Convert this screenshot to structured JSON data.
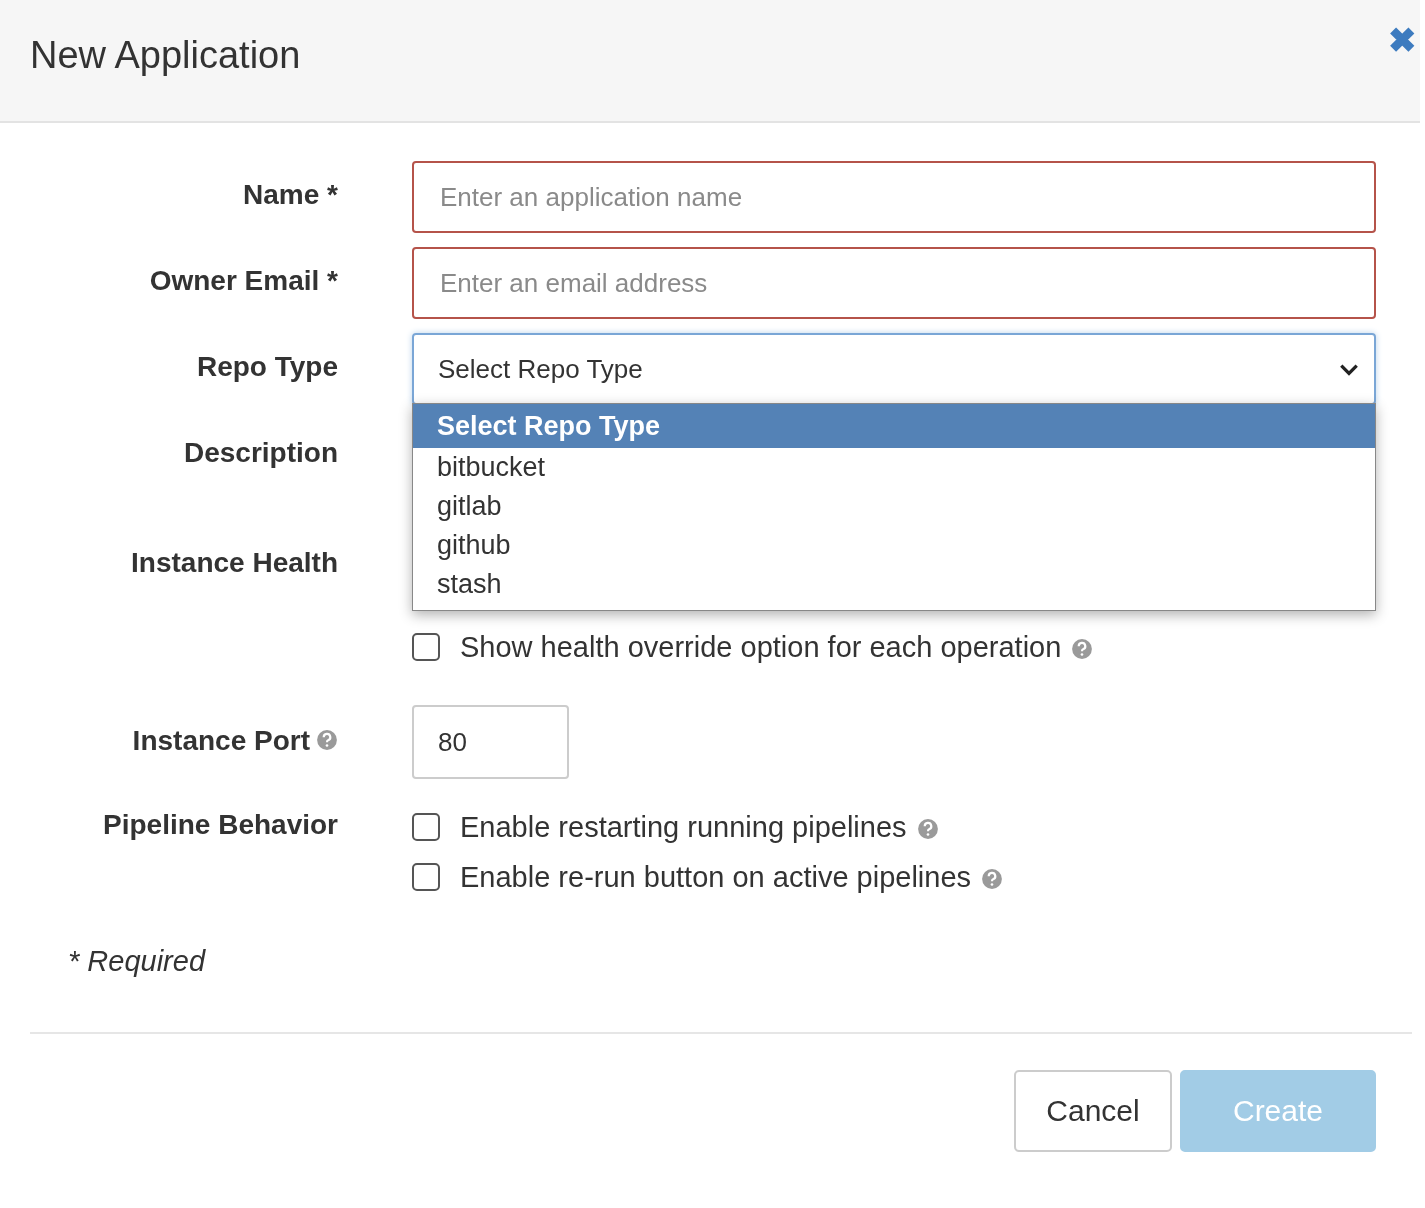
{
  "dialog": {
    "title": "New Application",
    "close_icon": "✖"
  },
  "fields": [
    {
      "label": "Name *",
      "kind": "text",
      "placeholder": "Enter an application name",
      "invalid": true
    },
    {
      "label": "Owner Email *",
      "kind": "text",
      "placeholder": "Enter an email address",
      "invalid": true
    },
    {
      "label": "Repo Type",
      "kind": "select",
      "value": "Select Repo Type",
      "expanded": true,
      "options": [
        {
          "label": "Select Repo Type",
          "selected": true
        },
        {
          "label": "bitbucket",
          "selected": false
        },
        {
          "label": "gitlab",
          "selected": false
        },
        {
          "label": "github",
          "selected": false
        },
        {
          "label": "stash",
          "selected": false
        }
      ]
    },
    {
      "label": "Description",
      "kind": "hidden"
    },
    {
      "label": "Instance Health",
      "kind": "checks",
      "checks": [
        {
          "label": "Show health override option for each operation",
          "checked": false,
          "help": true
        }
      ]
    },
    {
      "label": "Instance Port",
      "kind": "port",
      "help": true,
      "value": "80"
    },
    {
      "label": "Pipeline Behavior",
      "kind": "checks",
      "checks": [
        {
          "label": "Enable restarting running pipelines",
          "checked": false,
          "help": true
        },
        {
          "label": "Enable re-run button on active pipelines",
          "checked": false,
          "help": true
        }
      ]
    }
  ],
  "required_note": "* Required",
  "buttons": [
    {
      "label": "Cancel",
      "kind": "default",
      "disabled": false
    },
    {
      "label": "Create",
      "kind": "primary",
      "disabled": true
    }
  ]
}
